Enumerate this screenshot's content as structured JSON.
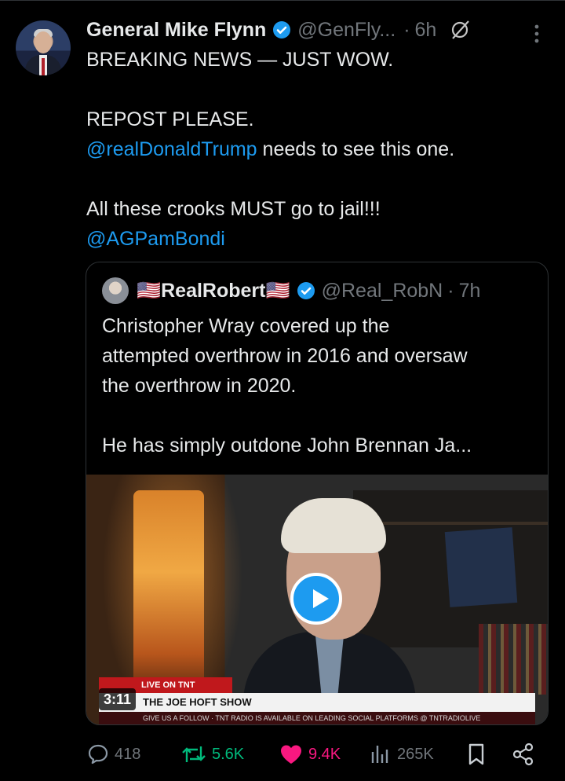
{
  "post": {
    "author_name": "General Mike Flynn",
    "author_handle": "@GenFly...",
    "separator": "·",
    "time": "6h",
    "text_lines": [
      "BREAKING NEWS — JUST WOW.",
      "REPOST PLEASE.",
      "All these crooks MUST go to jail!!!"
    ],
    "mention_1": "@realDonaldTrump",
    "mention_1_suffix": " needs to see this one.",
    "mention_2": "@AGPamBondi"
  },
  "quoted": {
    "author_name": "🇺🇸RealRobert🇺🇸",
    "author_handle": "@Real_RobN",
    "separator": "·",
    "time": "7h",
    "text_lines": [
      "Christopher Wray covered up the",
      "attempted overthrow in 2016 and oversaw",
      "the overthrow in 2020.",
      "He has simply outdone John Brennan Ja..."
    ],
    "video": {
      "duration": "3:11",
      "banner_live": "LIVE ON TNT",
      "banner_show": "THE JOE HOFT SHOW",
      "banner_ticker": "GIVE US A FOLLOW · TNT RADIO IS AVAILABLE ON LEADING SOCIAL PLATFORMS @ TNTRADIOLIVE"
    }
  },
  "actions": {
    "replies": "418",
    "reposts": "5.6K",
    "likes": "9.4K",
    "views": "265K"
  },
  "colors": {
    "accent": "#1d9bf0",
    "repost": "#00ba7c",
    "like": "#f91880",
    "muted": "#71767b"
  }
}
